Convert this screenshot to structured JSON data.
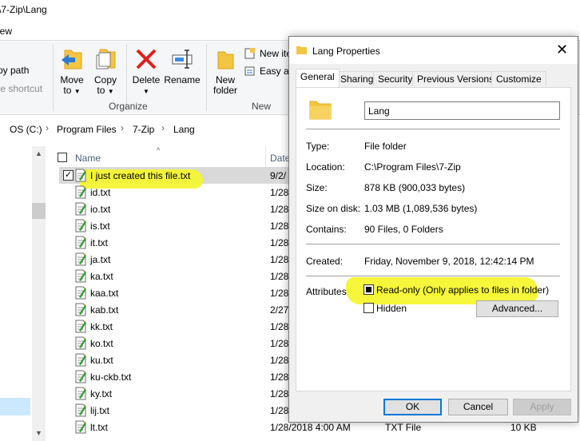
{
  "explorer": {
    "title": "\\7-Zip\\Lang",
    "menu_view": "iew",
    "ribbon": {
      "copy_path": "py path",
      "paste_shortcut": "te shortcut",
      "move_to": "Move",
      "move_to_2": "to",
      "copy_to": "Copy",
      "copy_to_2": "to",
      "delete": "Delete",
      "rename": "Rename",
      "new_folder": "New",
      "new_folder_2": "folder",
      "new_item": "New ite",
      "easy_access": "Easy ac",
      "organize_label": "Organize",
      "new_label": "New"
    },
    "breadcrumb": [
      "OS (C:)",
      "Program Files",
      "7-Zip",
      "Lang"
    ],
    "columns": {
      "name": "Name",
      "date": "Date"
    },
    "files": [
      {
        "name": "I just created this file.txt",
        "date": "9/2/",
        "type": "",
        "size": "",
        "selected": true
      },
      {
        "name": "id.txt",
        "date": "1/28",
        "type": "",
        "size": ""
      },
      {
        "name": "io.txt",
        "date": "1/28",
        "type": "",
        "size": ""
      },
      {
        "name": "is.txt",
        "date": "1/28",
        "type": "",
        "size": ""
      },
      {
        "name": "it.txt",
        "date": "1/28",
        "type": "",
        "size": ""
      },
      {
        "name": "ja.txt",
        "date": "1/28",
        "type": "",
        "size": ""
      },
      {
        "name": "ka.txt",
        "date": "1/28",
        "type": "",
        "size": ""
      },
      {
        "name": "kaa.txt",
        "date": "1/28",
        "type": "",
        "size": ""
      },
      {
        "name": "kab.txt",
        "date": "2/27",
        "type": "",
        "size": ""
      },
      {
        "name": "kk.txt",
        "date": "1/28",
        "type": "",
        "size": ""
      },
      {
        "name": "ko.txt",
        "date": "1/28",
        "type": "",
        "size": ""
      },
      {
        "name": "ku.txt",
        "date": "1/28",
        "type": "",
        "size": ""
      },
      {
        "name": "ku-ckb.txt",
        "date": "1/28",
        "type": "",
        "size": ""
      },
      {
        "name": "ky.txt",
        "date": "1/28",
        "type": "",
        "size": ""
      },
      {
        "name": "lij.txt",
        "date": "1/28",
        "type": "",
        "size": ""
      },
      {
        "name": "lt.txt",
        "date": "1/28/2018 4:00 AM",
        "type": "TXT File",
        "size": "10 KB"
      }
    ]
  },
  "dialog": {
    "title": "Lang Properties",
    "close": "✕",
    "tabs": [
      "General",
      "Sharing",
      "Security",
      "Previous Versions",
      "Customize"
    ],
    "folder_name": "Lang",
    "type_label": "Type:",
    "type_value": "File folder",
    "location_label": "Location:",
    "location_value": "C:\\Program Files\\7-Zip",
    "size_label": "Size:",
    "size_value": "878 KB (900,033 bytes)",
    "size_on_disk_label": "Size on disk:",
    "size_on_disk_value": "1.03 MB (1,089,536 bytes)",
    "contains_label": "Contains:",
    "contains_value": "90 Files, 0 Folders",
    "created_label": "Created:",
    "created_value": "Friday, November 9, 2018, 12:42:14 PM",
    "attributes_label": "Attributes:",
    "readonly_label": "Read-only (Only applies to files in folder)",
    "hidden_label": "Hidden",
    "advanced_button": "Advanced...",
    "ok_button": "OK",
    "cancel_button": "Cancel",
    "apply_button": "Apply"
  },
  "colors": {
    "highlight": "#f5f52a",
    "accent": "#0078d7",
    "selection": "#cce8ff"
  }
}
